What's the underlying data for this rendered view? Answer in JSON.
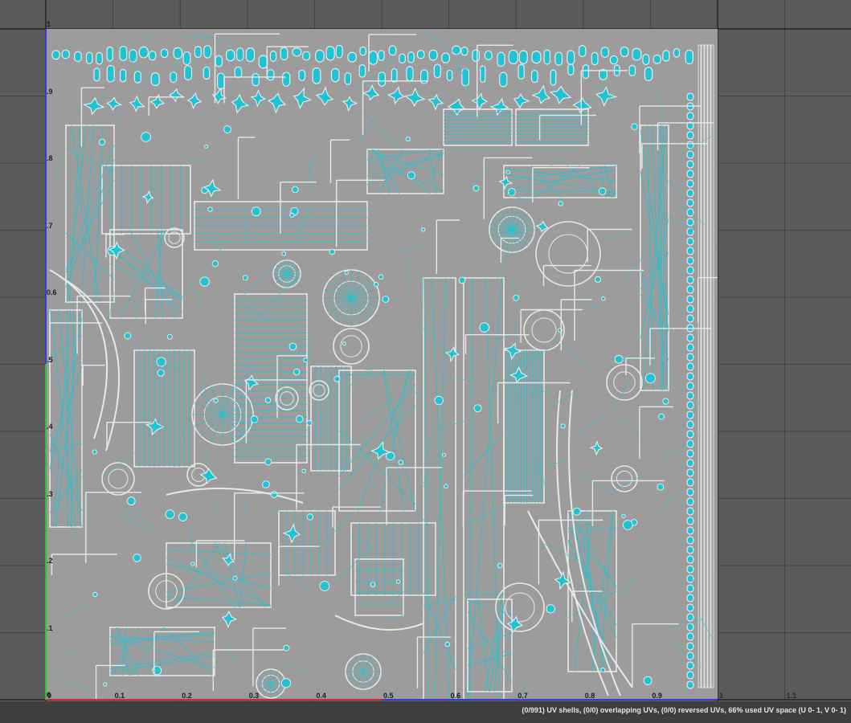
{
  "editor": {
    "status": "(0/991) UV shells, (0/0) overlapping UVs, (0/0) reversed UVs, 66% used UV space (U  0- 1, V  0- 1)"
  },
  "grid": {
    "v_labels": [
      "1",
      ".9",
      ".8",
      ".7",
      "0.6",
      ".5",
      ".4",
      ".3",
      ".2",
      ".1",
      "0"
    ],
    "u_labels": [
      "0",
      "0.1",
      "0.2",
      "0.3",
      "0.4",
      "0.5",
      "0.6",
      "0.7",
      "0.8",
      "0.9",
      "1",
      "1.1"
    ]
  },
  "colors": {
    "uv_shell_fill": "#9c9c9c",
    "uv_border": "#e8e8e8",
    "uv_wire": "#1fc3d4",
    "axis_u": "#d02c2c",
    "axis_v": "#2fbf2f",
    "axis_blue": "#3b3bd0"
  }
}
